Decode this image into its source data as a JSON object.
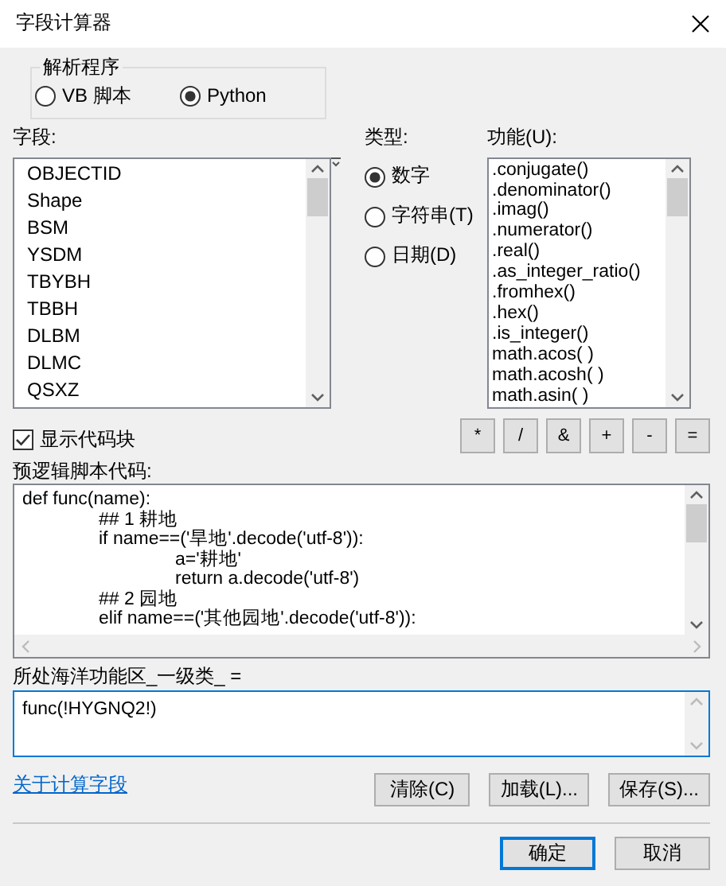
{
  "window": {
    "title": "字段计算器"
  },
  "parser": {
    "label": "解析程序",
    "options": [
      {
        "label": "VB 脚本",
        "selected": false
      },
      {
        "label": "Python",
        "selected": true
      }
    ]
  },
  "fields": {
    "label": "字段:",
    "items": [
      "OBJECTID",
      "Shape",
      "BSM",
      "YSDM",
      "TBYBH",
      "TBBH",
      "DLBM",
      "DLMC",
      "QSXZ"
    ]
  },
  "type": {
    "label": "类型:",
    "options": [
      {
        "label": "数字",
        "selected": true
      },
      {
        "label": "字符串(T)",
        "selected": false
      },
      {
        "label": "日期(D)",
        "selected": false
      }
    ]
  },
  "functions": {
    "label": "功能(U):",
    "items": [
      ".conjugate()",
      ".denominator()",
      ".imag()",
      ".numerator()",
      ".real()",
      ".as_integer_ratio()",
      ".fromhex()",
      ".hex()",
      ".is_integer()",
      "math.acos( )",
      "math.acosh( )",
      "math.asin( )"
    ]
  },
  "operators": [
    "*",
    "/",
    "&",
    "+",
    "-",
    "="
  ],
  "show_code_block": {
    "label": "显示代码块",
    "checked": true
  },
  "pre_logic": {
    "label": "预逻辑脚本代码:",
    "lines": [
      {
        "text": "def func(name):",
        "children": [
          {
            "text": "## 1 耕地"
          },
          {
            "text": "if name==('旱地'.decode('utf-8')):",
            "children": [
              {
                "text": "a='耕地'"
              },
              {
                "text": "return a.decode('utf-8')"
              }
            ]
          },
          {
            "text": "## 2 园地"
          },
          {
            "text": "elif name==('其他园地'.decode('utf-8')):"
          }
        ]
      }
    ]
  },
  "expression": {
    "label": "所处海洋功能区_一级类_ =",
    "value": "func(!HYGNQ2!)"
  },
  "help_link": "关于计算字段",
  "file_buttons": [
    "清除(C)",
    "加载(L)...",
    "保存(S)..."
  ],
  "dialog_buttons": [
    {
      "label": "确定",
      "default": true
    },
    {
      "label": "取消",
      "default": false
    }
  ]
}
